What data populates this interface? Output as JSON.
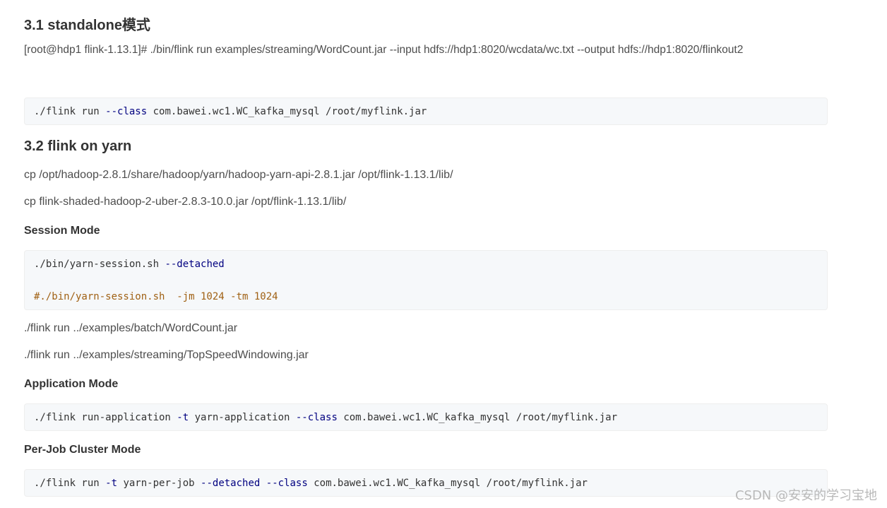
{
  "sections": {
    "s31_heading": "3.1 standalone模式",
    "s31_command": "[root@hdp1 flink-1.13.1]# ./bin/flink run examples/streaming/WordCount.jar --input hdfs://hdp1:8020/wcdata/wc.txt --output hdfs://hdp1:8020/flinkout2",
    "s31_code": {
      "c1": "./flink run ",
      "c2": "--class",
      "c3": " com.bawei.wc1.WC_kafka_mysql /root/myflink.jar"
    },
    "s32_heading": "3.2 flink on yarn",
    "s32_cp1": "cp  /opt/hadoop-2.8.1/share/hadoop/yarn/hadoop-yarn-api-2.8.1.jar  /opt/flink-1.13.1/lib/",
    "s32_cp2": "cp  flink-shaded-hadoop-2-uber-2.8.3-10.0.jar  /opt/flink-1.13.1/lib/",
    "session_heading": "Session Mode",
    "session_code": {
      "l1a": "./bin/yarn-session.sh ",
      "l1b": "--detached",
      "l2": "#./bin/yarn-session.sh  -jm 1024 -tm 1024"
    },
    "session_run1": "./flink run ../examples/batch/WordCount.jar",
    "session_run2": "./flink run ../examples/streaming/TopSpeedWindowing.jar",
    "application_heading": "Application Mode",
    "application_code": {
      "c1": "./flink run-application ",
      "c2": "-t",
      "c3": " yarn-application ",
      "c4": "--class",
      "c5": " com.bawei.wc1.WC_kafka_mysql /root/myflink.jar"
    },
    "perjob_heading": "Per-Job Cluster Mode",
    "perjob_code": {
      "c1": "./flink run ",
      "c2": "-t",
      "c3": " yarn-per-job ",
      "c4": "--detached",
      "c5": " ",
      "c6": "--class",
      "c7": " com.bawei.wc1.WC_kafka_mysql /root/myflink.jar"
    }
  },
  "watermark": "CSDN @安安的学习宝地",
  "colors": {
    "keyword": "#000080",
    "comment": "#a06114",
    "code_bg": "#f6f8fa",
    "text": "#4d4d4d",
    "heading": "#333333"
  }
}
